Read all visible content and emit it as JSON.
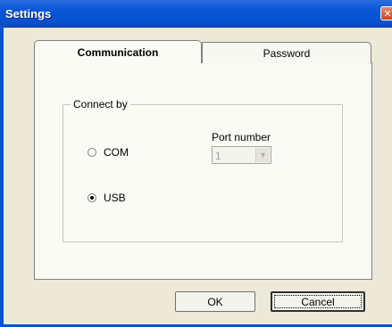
{
  "window": {
    "title": "Settings",
    "close_glyph": "✕",
    "close_icon": "close-icon"
  },
  "tabs": [
    {
      "label": "Communication",
      "active": true
    },
    {
      "label": "Password",
      "active": false
    }
  ],
  "connect_group": {
    "legend": "Connect by",
    "options": [
      {
        "label": "COM",
        "checked": false
      },
      {
        "label": "USB",
        "checked": true
      }
    ],
    "port": {
      "label": "Port number",
      "value": "1",
      "enabled": false
    }
  },
  "buttons": {
    "ok": "OK",
    "cancel": "Cancel"
  },
  "colors": {
    "titlebar": "#0653d2",
    "dialog_bg": "#ece9d8",
    "panel_bg": "#fbfbf6"
  }
}
